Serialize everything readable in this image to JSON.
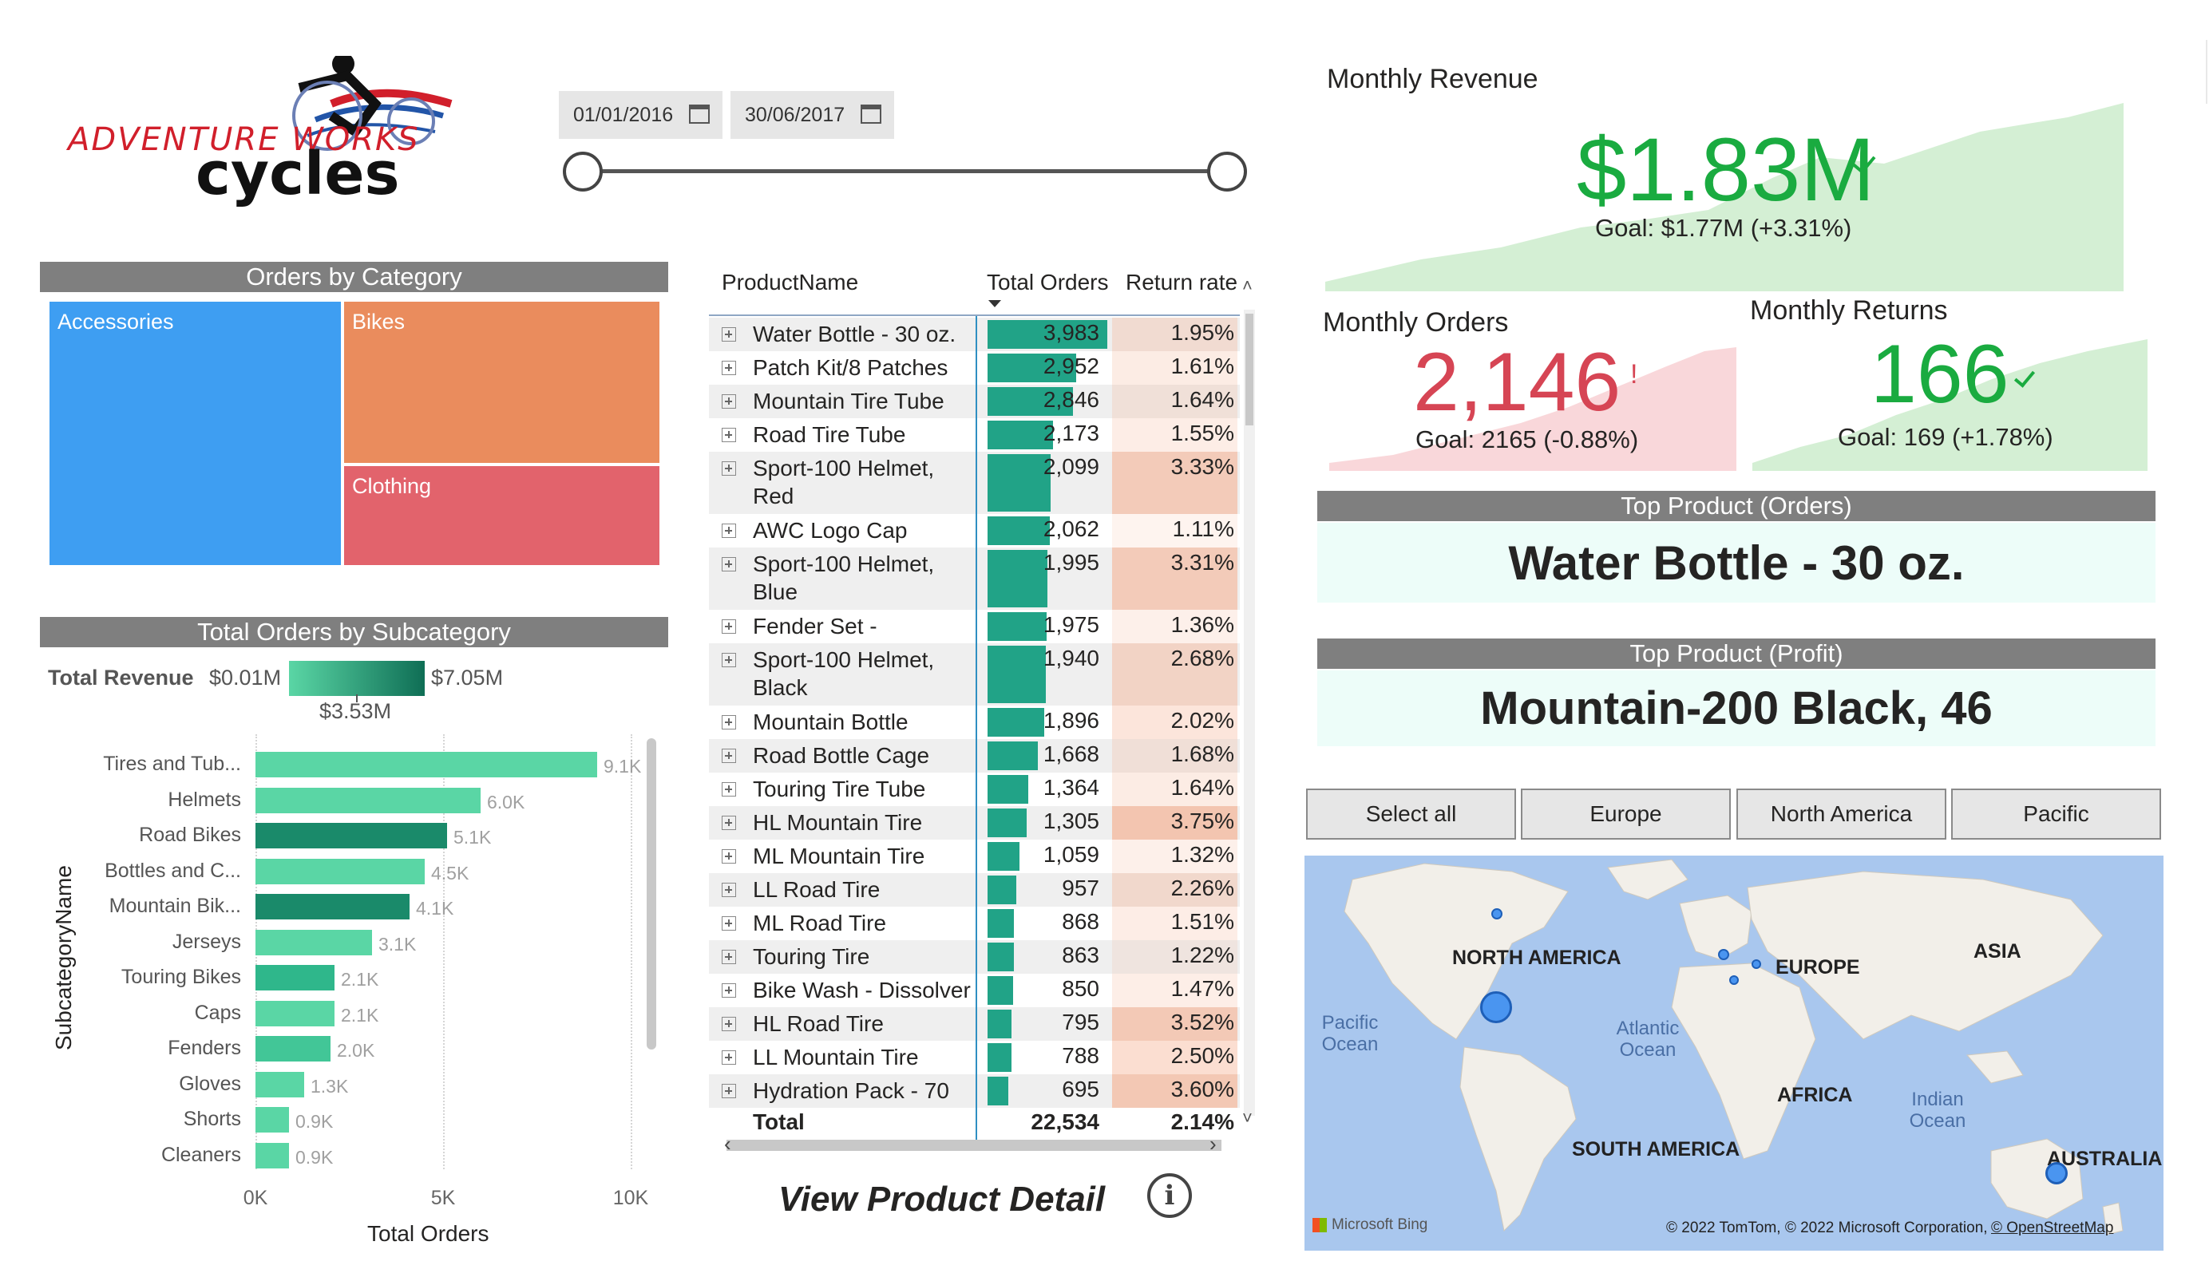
{
  "logo": {
    "line1": "ADVENTURE WORKS",
    "line2": "cycles"
  },
  "date_slicer": {
    "start": "01/01/2016",
    "end": "30/06/2017"
  },
  "orders_by_category": {
    "title": "Orders by Category",
    "tiles": [
      {
        "label": "Accessories",
        "color": "#3e9ef2"
      },
      {
        "label": "Bikes",
        "color": "#ea8c5d"
      },
      {
        "label": "Clothing",
        "color": "#e2636c"
      }
    ]
  },
  "subcategory_chart": {
    "title": "Total Orders by Subcategory",
    "legend": {
      "label": "Total Revenue",
      "min": "$0.01M",
      "max": "$7.05M",
      "mid": "$3.53M"
    }
  },
  "chart_data": {
    "type": "bar",
    "orientation": "horizontal",
    "categories": [
      "Tires and Tub...",
      "Helmets",
      "Road Bikes",
      "Bottles and C...",
      "Mountain Bik...",
      "Jerseys",
      "Touring Bikes",
      "Caps",
      "Fenders",
      "Gloves",
      "Shorts",
      "Cleaners"
    ],
    "values": [
      9100,
      6000,
      5100,
      4500,
      4100,
      3100,
      2100,
      2100,
      2000,
      1300,
      900,
      900
    ],
    "value_labels": [
      "9.1K",
      "6.0K",
      "5.1K",
      "4.5K",
      "4.1K",
      "3.1K",
      "2.1K",
      "2.1K",
      "2.0K",
      "1.3K",
      "0.9K",
      "0.9K"
    ],
    "bar_colors": [
      "#5ad6a5",
      "#5ad6a5",
      "#1a8a6a",
      "#5ad6a5",
      "#1a8a6a",
      "#5ad6a5",
      "#2fb78b",
      "#5ad6a5",
      "#42c697",
      "#5ad6a5",
      "#5ad6a5",
      "#5ad6a5"
    ],
    "xlabel": "Total Orders",
    "ylabel": "SubcategoryName",
    "xticks": [
      "0K",
      "5K",
      "10K"
    ],
    "xlim": [
      0,
      10000
    ],
    "grid": true
  },
  "product_table": {
    "headers": {
      "name": "ProductName",
      "orders": "Total Orders",
      "rate": "Return rate"
    },
    "rows": [
      {
        "name": "Water Bottle - 30 oz.",
        "orders": "3,983",
        "rate": "1.95%",
        "value": 3983,
        "rate_value": 1.95
      },
      {
        "name": "Patch Kit/8 Patches",
        "orders": "2,952",
        "rate": "1.61%",
        "value": 2952,
        "rate_value": 1.61
      },
      {
        "name": "Mountain Tire Tube",
        "orders": "2,846",
        "rate": "1.64%",
        "value": 2846,
        "rate_value": 1.64
      },
      {
        "name": "Road Tire Tube",
        "orders": "2,173",
        "rate": "1.55%",
        "value": 2173,
        "rate_value": 1.55
      },
      {
        "name": "Sport-100 Helmet,",
        "name2": "Red",
        "orders": "2,099",
        "rate": "3.33%",
        "value": 2099,
        "rate_value": 3.33
      },
      {
        "name": "AWC Logo Cap",
        "orders": "2,062",
        "rate": "1.11%",
        "value": 2062,
        "rate_value": 1.11
      },
      {
        "name": "Sport-100 Helmet,",
        "name2": "Blue",
        "orders": "1,995",
        "rate": "3.31%",
        "value": 1995,
        "rate_value": 3.31
      },
      {
        "name": "Fender Set -",
        "orders": "1,975",
        "rate": "1.36%",
        "value": 1975,
        "rate_value": 1.36
      },
      {
        "name": "Sport-100 Helmet,",
        "name2": "Black",
        "orders": "1,940",
        "rate": "2.68%",
        "value": 1940,
        "rate_value": 2.68
      },
      {
        "name": "Mountain Bottle",
        "orders": "1,896",
        "rate": "2.02%",
        "value": 1896,
        "rate_value": 2.02
      },
      {
        "name": "Road Bottle Cage",
        "orders": "1,668",
        "rate": "1.68%",
        "value": 1668,
        "rate_value": 1.68
      },
      {
        "name": "Touring Tire Tube",
        "orders": "1,364",
        "rate": "1.64%",
        "value": 1364,
        "rate_value": 1.64
      },
      {
        "name": "HL Mountain Tire",
        "orders": "1,305",
        "rate": "3.75%",
        "value": 1305,
        "rate_value": 3.75
      },
      {
        "name": "ML Mountain Tire",
        "orders": "1,059",
        "rate": "1.32%",
        "value": 1059,
        "rate_value": 1.32
      },
      {
        "name": "LL Road Tire",
        "orders": "957",
        "rate": "2.26%",
        "value": 957,
        "rate_value": 2.26
      },
      {
        "name": "ML Road Tire",
        "orders": "868",
        "rate": "1.51%",
        "value": 868,
        "rate_value": 1.51
      },
      {
        "name": "Touring Tire",
        "orders": "863",
        "rate": "1.22%",
        "value": 863,
        "rate_value": 1.22
      },
      {
        "name": "Bike Wash - Dissolver",
        "orders": "850",
        "rate": "1.47%",
        "value": 850,
        "rate_value": 1.47
      },
      {
        "name": "HL Road Tire",
        "orders": "795",
        "rate": "3.52%",
        "value": 795,
        "rate_value": 3.52
      },
      {
        "name": "LL Mountain Tire",
        "orders": "788",
        "rate": "2.50%",
        "value": 788,
        "rate_value": 2.5
      },
      {
        "name": "Hydration Pack - 70",
        "orders": "695",
        "rate": "3.60%",
        "value": 695,
        "rate_value": 3.6
      }
    ],
    "total": {
      "label": "Total",
      "orders": "22,534",
      "rate": "2.14%"
    }
  },
  "view_detail": {
    "label": "View Product Detail",
    "icon": "info-icon"
  },
  "kpis": {
    "revenue": {
      "title": "Monthly Revenue",
      "value": "$1.83M",
      "goal": "Goal: $1.77M (+3.31%)",
      "color": "#1aab40",
      "status": "check"
    },
    "orders": {
      "title": "Monthly Orders",
      "value": "2,146",
      "goal": "Goal: 2165 (-0.88%)",
      "color": "#d64554",
      "status": "!"
    },
    "returns": {
      "title": "Monthly Returns",
      "value": "166",
      "goal": "Goal: 169 (+1.78%)",
      "color": "#1aab40",
      "status": "check"
    }
  },
  "top_product_orders": {
    "title": "Top Product (Orders)",
    "value": "Water Bottle - 30 oz."
  },
  "top_product_profit": {
    "title": "Top Product (Profit)",
    "value": "Mountain-200 Black, 46"
  },
  "region_buttons": [
    "Select all",
    "Europe",
    "North America",
    "Pacific"
  ],
  "map": {
    "labels": {
      "north_america": "NORTH AMERICA",
      "europe": "EUROPE",
      "asia": "ASIA",
      "africa": "AFRICA",
      "south_america": "SOUTH AMERICA",
      "australia": "AUSTRALIA",
      "pacific_ocean": "Pacific Ocean",
      "atlantic_ocean": "Atlantic Ocean",
      "indian_ocean": "Indian Ocean"
    },
    "bing": "Microsoft Bing",
    "copyright": "© 2022 TomTom, © 2022 Microsoft Corporation,",
    "osm": "© OpenStreetMap"
  }
}
